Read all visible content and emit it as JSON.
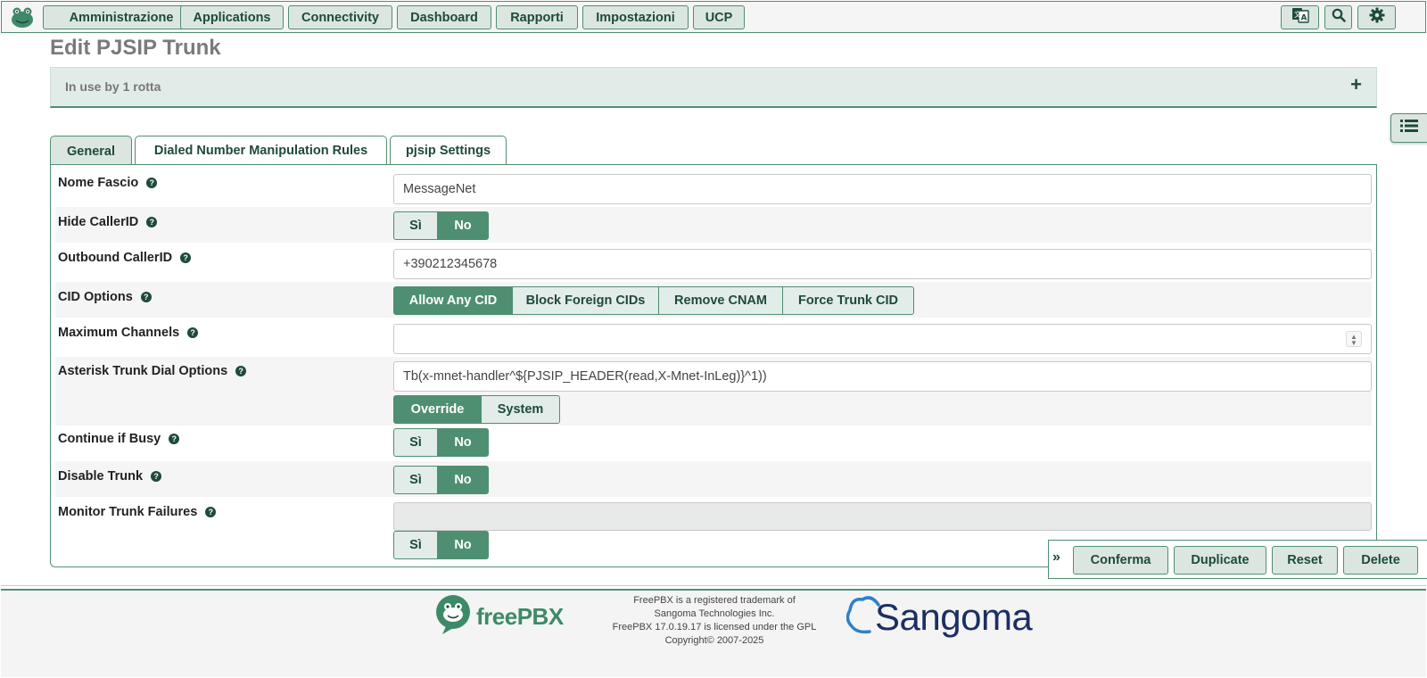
{
  "nav": {
    "items": [
      {
        "label": "Amministrazione"
      },
      {
        "label": "Applications"
      },
      {
        "label": "Connectivity"
      },
      {
        "label": "Dashboard"
      },
      {
        "label": "Rapporti"
      },
      {
        "label": "Impostazioni"
      },
      {
        "label": "UCP"
      }
    ],
    "right_icons": [
      "language-icon",
      "search-icon",
      "gear-icon"
    ]
  },
  "page": {
    "title": "Edit PJSIP Trunk",
    "usage_text": "In use by 1 rotta",
    "usage_toggle": "+"
  },
  "tabs": [
    {
      "label": "General",
      "active": true
    },
    {
      "label": "Dialed Number Manipulation Rules",
      "active": false
    },
    {
      "label": "pjsip Settings",
      "active": false
    }
  ],
  "form": {
    "trunk_name": {
      "label": "Nome Fascio",
      "value": "MessageNet"
    },
    "hide_callerid": {
      "label": "Hide CallerID",
      "options": [
        "Sì",
        "No"
      ],
      "selected": "No"
    },
    "outbound_callerid": {
      "label": "Outbound CallerID",
      "value": "+390212345678"
    },
    "cid_options": {
      "label": "CID Options",
      "options": [
        "Allow Any CID",
        "Block Foreign CIDs",
        "Remove CNAM",
        "Force Trunk CID"
      ],
      "selected": "Allow Any CID"
    },
    "max_channels": {
      "label": "Maximum Channels",
      "value": ""
    },
    "dial_options": {
      "label": "Asterisk Trunk Dial Options",
      "value": "Tb(x-mnet-handler^${PJSIP_HEADER(read,X-Mnet-InLeg)}^1))",
      "options": [
        "Override",
        "System"
      ],
      "selected": "Override"
    },
    "continue_busy": {
      "label": "Continue if Busy",
      "options": [
        "Sì",
        "No"
      ],
      "selected": "No"
    },
    "disable_trunk": {
      "label": "Disable Trunk",
      "options": [
        "Sì",
        "No"
      ],
      "selected": "No"
    },
    "monitor_failures": {
      "label": "Monitor Trunk Failures",
      "value": "",
      "options": [
        "Sì",
        "No"
      ],
      "selected": "No"
    }
  },
  "help_glyph": "?",
  "actions": {
    "expand": "»",
    "buttons": [
      "Conferma",
      "Duplicate",
      "Reset",
      "Delete"
    ]
  },
  "footer": {
    "freepbx_logo": "freePBX",
    "lines": [
      "FreePBX is a registered trademark of",
      "Sangoma Technologies Inc.",
      "FreePBX 17.0.19.17 is licensed under the GPL",
      "Copyright© 2007-2025"
    ],
    "sangoma_logo": "Sangoma"
  },
  "colors": {
    "brand_green": "#4f8f71",
    "button_bg": "#dbe6e1",
    "text_dark_green": "#1e4a3c"
  }
}
